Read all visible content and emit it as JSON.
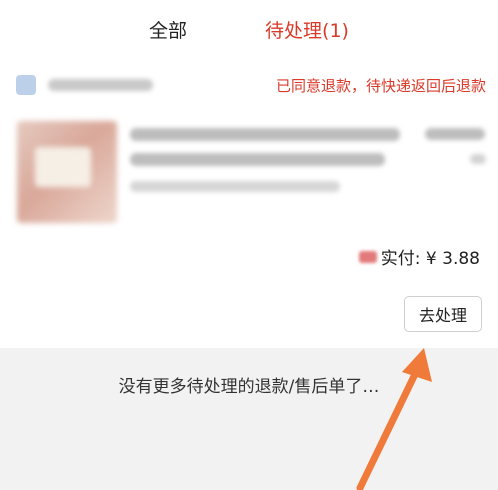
{
  "tabs": [
    {
      "label": "全部",
      "active": false
    },
    {
      "label": "待处理(1)",
      "active": true
    }
  ],
  "order": {
    "status": "已同意退款，待快递返回后退款",
    "amount_label": "实付: ¥ 3.88",
    "process_button": "去处理"
  },
  "footer": {
    "end_text": "没有更多待处理的退款/售后单了…"
  },
  "colors": {
    "accent": "#d93a2a",
    "arrow": "#f07a3a"
  }
}
